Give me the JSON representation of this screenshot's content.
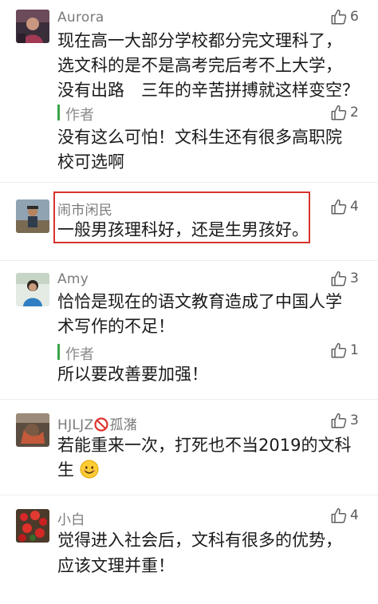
{
  "comments": [
    {
      "user": "Aurora",
      "likes": "6",
      "lines": [
        "现在高一大部分学校都分完文理科了，",
        "选文科的是不是高考完后考不上大学，",
        "没有出路　三年的辛苦拼搏就这样变空？"
      ],
      "reply": {
        "label": "作者",
        "likes": "2",
        "lines": [
          "没有这么可怕！文科生还有很多高职院",
          "校可选啊"
        ]
      }
    },
    {
      "user": "闹市闲民",
      "likes": "4",
      "lines": [
        "一般男孩理科好，还是生男孩好。"
      ]
    },
    {
      "user": "Amy",
      "likes": "3",
      "lines": [
        "恰恰是现在的语文教育造成了中国人学",
        "术写作的不足！"
      ],
      "reply": {
        "label": "作者",
        "likes": "1",
        "lines": [
          "所以要改善要加强！"
        ]
      }
    },
    {
      "user_prefix": "HJLJZ",
      "user_suffix": "孤潴",
      "likes": "3",
      "lines": [
        "若能重来一次，打死也不当2019的文科",
        "生"
      ]
    },
    {
      "user": "小白",
      "likes": "4",
      "lines": [
        "觉得进入社会后，文科有很多的优势，",
        "应该文理并重！"
      ]
    }
  ],
  "icons": {
    "like": "thumbs-up-icon",
    "ban": "no-entry-icon",
    "smile": "smiling-face-icon"
  },
  "colors": {
    "author_bar": "#3aa54a",
    "highlight_border": "#d7332d",
    "name": "#7b7b7b"
  }
}
